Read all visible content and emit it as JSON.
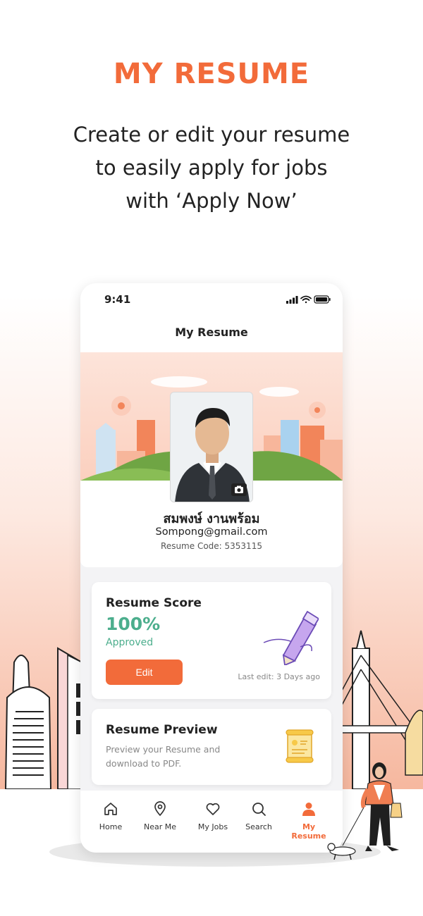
{
  "hero": {
    "title": "MY RESUME",
    "subtitle_lines": [
      "Create or edit your resume",
      "to easily apply for jobs",
      "with ‘Apply Now’"
    ]
  },
  "phone": {
    "status_time": "9:41",
    "nav_title": "My Resume",
    "profile": {
      "name": "สมพงษ์ งานพร้อม",
      "email": "Sompong@gmail.com",
      "resume_code": "Resume Code: 5353115"
    },
    "score_card": {
      "title": "Resume Score",
      "value": "100%",
      "status": "Approved",
      "edit_label": "Edit",
      "last_edit": "Last edit: 3 Days ago"
    },
    "preview_card": {
      "title": "Resume Preview",
      "description": "Preview your Resume and download to PDF."
    },
    "tabs": [
      {
        "label": "Home",
        "icon": "home-icon",
        "active": false
      },
      {
        "label": "Near Me",
        "icon": "location-pin-icon",
        "active": false
      },
      {
        "label": "My Jobs",
        "icon": "heart-icon",
        "active": false
      },
      {
        "label": "Search",
        "icon": "search-icon",
        "active": false
      },
      {
        "label": "My Resume",
        "icon": "person-icon",
        "active": true
      }
    ]
  },
  "colors": {
    "accent": "#f26b3a",
    "success": "#4cae8d",
    "muted": "#888888"
  }
}
